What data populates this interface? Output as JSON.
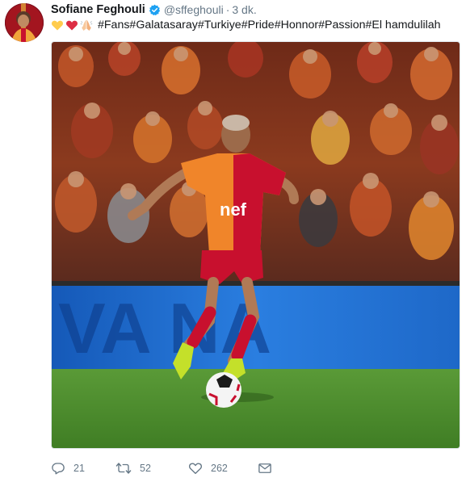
{
  "tweet": {
    "author_name": "Sofiane Feghouli",
    "handle": "@sffeghouli",
    "separator": "·",
    "time": "3 dk.",
    "emojis": [
      "yellow-heart-icon",
      "red-heart-icon",
      "folded-hands-icon"
    ],
    "text": "#Fans#Galatasaray#Turkiye#Pride#Honnor#Passion#El hamdulilah",
    "media": {
      "banner_text": "VA  NA",
      "sponsor_text": "nef"
    },
    "actions": {
      "reply_count": "21",
      "retweet_count": "52",
      "like_count": "262"
    }
  },
  "colors": {
    "verified": "#1da1f2",
    "secondary_text": "#657786",
    "pitch": "#4f8f2e",
    "banner": "#1d6fc9",
    "kit_orange": "#f0852a",
    "kit_red": "#c8102e"
  }
}
